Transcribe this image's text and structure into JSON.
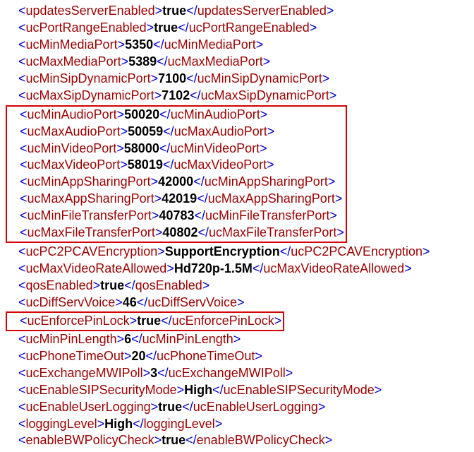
{
  "lines": [
    {
      "tag": "updatesServerEnabled",
      "value": "true"
    },
    {
      "tag": "ucPortRangeEnabled",
      "value": "true"
    },
    {
      "tag": "ucMinMediaPort",
      "value": "5350"
    },
    {
      "tag": "ucMaxMediaPort",
      "value": "5389"
    },
    {
      "tag": "ucMinSipDynamicPort",
      "value": "7100"
    },
    {
      "tag": "ucMaxSipDynamicPort",
      "value": "7102"
    },
    {
      "tag": "ucMinAudioPort",
      "value": "50020"
    },
    {
      "tag": "ucMaxAudioPort",
      "value": "50059"
    },
    {
      "tag": "ucMinVideoPort",
      "value": "58000"
    },
    {
      "tag": "ucMaxVideoPort",
      "value": "58019"
    },
    {
      "tag": "ucMinAppSharingPort",
      "value": "42000"
    },
    {
      "tag": "ucMaxAppSharingPort",
      "value": "42019"
    },
    {
      "tag": "ucMinFileTransferPort",
      "value": "40783"
    },
    {
      "tag": "ucMaxFileTransferPort",
      "value": "40802"
    },
    {
      "tag": "ucPC2PCAVEncryption",
      "value": "SupportEncryption"
    },
    {
      "tag": "ucMaxVideoRateAllowed",
      "value": "Hd720p-1.5M"
    },
    {
      "tag": "qosEnabled",
      "value": "true"
    },
    {
      "tag": "ucDiffServVoice",
      "value": "46"
    },
    {
      "tag": "ucEnforcePinLock",
      "value": "true"
    },
    {
      "tag": "ucMinPinLength",
      "value": "6"
    },
    {
      "tag": "ucPhoneTimeOut",
      "value": "20"
    },
    {
      "tag": "ucExchangeMWIPoll",
      "value": "3"
    },
    {
      "tag": "ucEnableSIPSecurityMode",
      "value": "High"
    },
    {
      "tag": "ucEnableUserLogging",
      "value": "true"
    },
    {
      "tag": "loggingLevel",
      "value": "High"
    },
    {
      "tag": "enableBWPolicyCheck",
      "value": "true"
    }
  ],
  "highlight_group": {
    "start": 6,
    "end": 13
  },
  "highlight_single": 18
}
